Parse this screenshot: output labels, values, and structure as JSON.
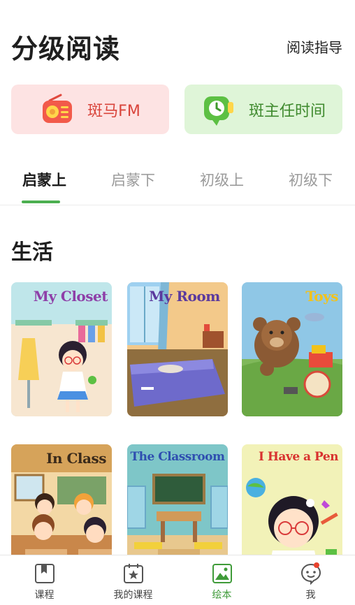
{
  "header": {
    "title": "分级阅读",
    "guide_link": "阅读指导"
  },
  "features": [
    {
      "label": "斑马FM",
      "icon": "radio-icon"
    },
    {
      "label": "斑主任时间",
      "icon": "clock-icon"
    }
  ],
  "tabs": [
    {
      "label": "启蒙上",
      "active": true
    },
    {
      "label": "启蒙下",
      "active": false
    },
    {
      "label": "初级上",
      "active": false
    },
    {
      "label": "初级下",
      "active": false
    }
  ],
  "section": {
    "title": "生活"
  },
  "books": [
    {
      "title": "My Closet",
      "title_color": "#8e3fa8"
    },
    {
      "title": "My Room",
      "title_color": "#5b3a9e"
    },
    {
      "title": "Toys",
      "title_color": "#f2c21b"
    },
    {
      "title": "In Class",
      "title_color": "#3a2a1a"
    },
    {
      "title": "The Classroom",
      "title_color": "#2f4fb0"
    },
    {
      "title": "I Have a Pen",
      "title_color": "#d8322f"
    }
  ],
  "bottom_nav": [
    {
      "label": "课程",
      "icon": "bookmark-book-icon",
      "active": false
    },
    {
      "label": "我的课程",
      "icon": "calendar-star-icon",
      "active": false
    },
    {
      "label": "绘本",
      "icon": "picture-book-icon",
      "active": true
    },
    {
      "label": "我",
      "icon": "face-icon",
      "active": false,
      "badge": true
    }
  ],
  "colors": {
    "accent": "#4caf50",
    "fm_bg": "#fde3e3",
    "time_bg": "#dff5d8",
    "badge": "#e8432e"
  }
}
